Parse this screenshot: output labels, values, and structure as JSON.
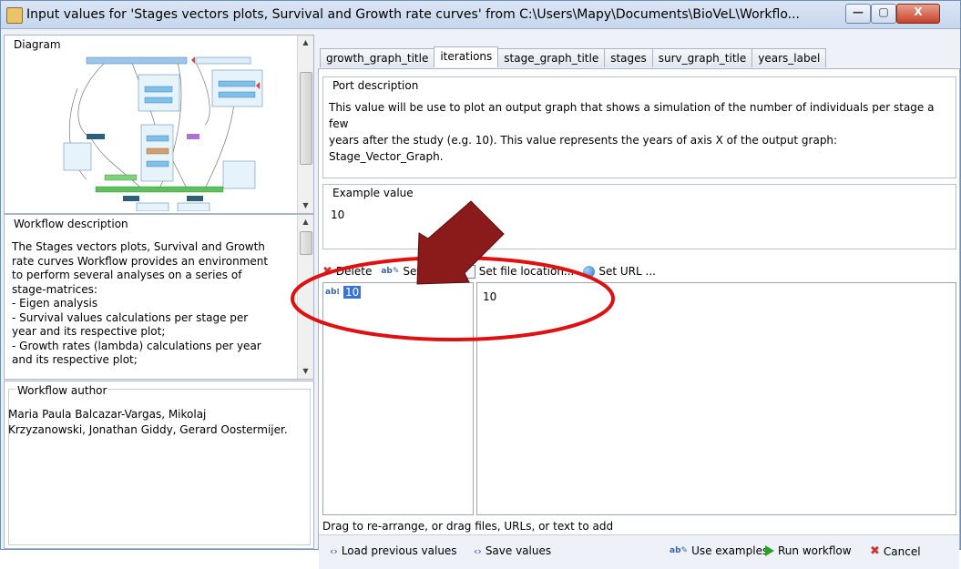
{
  "window": {
    "title": "Input values for 'Stages vectors plots, Survival and Growth rate curves' from C:\\Users\\Mapy\\Documents\\BioVeL\\Workflo...",
    "min_glyph": "—",
    "max_glyph": "▢",
    "close_glyph": "X"
  },
  "left": {
    "diagram_title": "Diagram",
    "description_title": "Workflow description",
    "description_lines": [
      "The Stages vectors plots, Survival and Growth",
      "rate curves Workflow provides an environment",
      "to perform several analyses on a series of",
      "stage-matrices:",
      "- Eigen analysis",
      "- Survival values calculations per stage per",
      "year and its respective plot;",
      "- Growth rates (lambda) calculations per year",
      "and its respective plot;"
    ],
    "author_title": "Workflow author",
    "author_lines": [
      "Maria Paula Balcazar-Vargas, Mikolaj",
      "Krzyzanowski, Jonathan Giddy, Gerard Oostermijer."
    ]
  },
  "tabs": [
    "growth_graph_title",
    "iterations",
    "stage_graph_title",
    "stages",
    "surv_graph_title",
    "years_label"
  ],
  "active_tab": "iterations",
  "port": {
    "title": "Port description",
    "lines": [
      "This value will be use to plot an output graph that shows a simulation of the number of individuals per stage a few",
      "years after the study (e.g. 10). This value represents the years of axis X of the output graph: Stage_Vector_Graph."
    ]
  },
  "example": {
    "title": "Example value",
    "value": "10"
  },
  "toolbar": {
    "delete": "Delete",
    "set_value": "Set value",
    "set_file": "Set file location...",
    "set_url": "Set URL ..."
  },
  "values_list": {
    "type_icon": "abc-icon",
    "item": "10",
    "preview": "10"
  },
  "hint": "Drag to re-arrange, or drag files, URLs, or text to add",
  "bottom": {
    "load_previous": "Load previous values",
    "save_values": "Save values",
    "use_examples": "Use examples",
    "run_workflow": "Run workflow",
    "cancel": "Cancel"
  },
  "colors": {
    "annotation_arrow": "#8b1a1a",
    "annotation_ellipse": "#e01010",
    "selection": "#3874d8"
  }
}
